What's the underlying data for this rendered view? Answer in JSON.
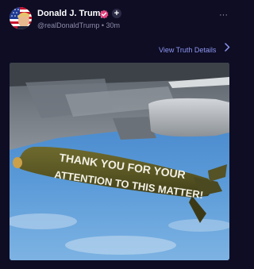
{
  "post": {
    "author_name": "Donald J. Trump",
    "handle": "@realDonaldTrump",
    "separator": "•",
    "time": "30m",
    "link_label": "View Truth Details",
    "more_label": "···"
  },
  "image": {
    "bomb_text_line1": "THANK YOU FOR YOUR",
    "bomb_text_line2": "ATTENTION TO THIS MATTER!"
  },
  "colors": {
    "background": "#0e0d24",
    "link": "#8e96f1",
    "verified_badge": "#e2447e",
    "muted_text": "#8d8ba8"
  },
  "icons": {
    "avatar": "american-flag-avatar",
    "verified": "verified-badge-icon",
    "follow": "plus-icon",
    "more": "more-dots-icon",
    "link_chevron": "chevron-right-icon"
  }
}
